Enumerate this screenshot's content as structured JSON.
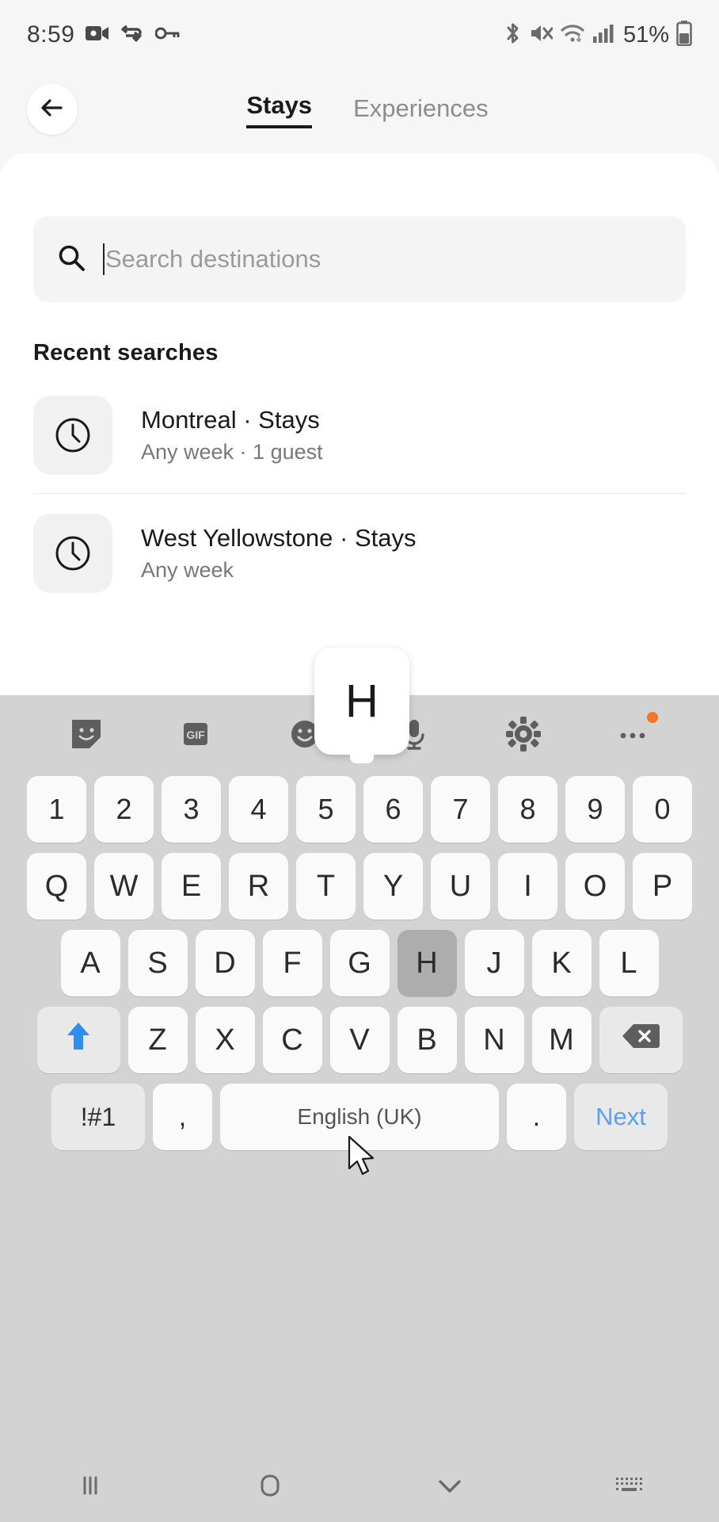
{
  "status_bar": {
    "time": "8:59",
    "left_icons": [
      "video-camera-icon",
      "vpn-icon",
      "key-icon"
    ],
    "right_icons": [
      "bluetooth-icon",
      "mute-icon",
      "wifi-icon",
      "signal-icon"
    ],
    "battery_percent": "51%"
  },
  "header": {
    "back_icon": "back-arrow-icon",
    "tabs": [
      {
        "label": "Stays",
        "active": true
      },
      {
        "label": "Experiences",
        "active": false
      }
    ]
  },
  "search": {
    "icon": "search-icon",
    "value": "",
    "placeholder": "Search destinations"
  },
  "recent": {
    "title": "Recent searches",
    "items": [
      {
        "icon": "clock-icon",
        "title": "Montreal · Stays",
        "subtitle": "Any week · 1 guest"
      },
      {
        "icon": "clock-icon",
        "title": "West Yellowstone · Stays",
        "subtitle": "Any week"
      }
    ]
  },
  "keyboard": {
    "toolbar": [
      {
        "name": "sticker-icon"
      },
      {
        "name": "gif-icon",
        "label": "GIF"
      },
      {
        "name": "emoji-icon"
      },
      {
        "name": "microphone-icon"
      },
      {
        "name": "settings-gear-icon"
      },
      {
        "name": "more-options-icon",
        "badge": true
      }
    ],
    "rows": {
      "numbers": [
        "1",
        "2",
        "3",
        "4",
        "5",
        "6",
        "7",
        "8",
        "9",
        "0"
      ],
      "row1": [
        "Q",
        "W",
        "E",
        "R",
        "T",
        "Y",
        "U",
        "I",
        "O",
        "P"
      ],
      "row2": [
        "A",
        "S",
        "D",
        "F",
        "G",
        "H",
        "J",
        "K",
        "L"
      ],
      "row3": [
        "Z",
        "X",
        "C",
        "V",
        "B",
        "N",
        "M"
      ]
    },
    "pressed_key": "H",
    "popup_key": "H",
    "shift_icon": "shift-up-arrow-icon",
    "backspace_icon": "backspace-icon",
    "bottom": {
      "symbols": "!#1",
      "comma": ",",
      "space_label": "English (UK)",
      "period": ".",
      "action": "Next"
    },
    "accent_color": "#5aa2ef",
    "badge_color": "#f5762a"
  },
  "navbar": {
    "items": [
      "recents-icon",
      "home-icon",
      "hide-keyboard-chevron-icon",
      "keyboard-switch-icon"
    ]
  }
}
